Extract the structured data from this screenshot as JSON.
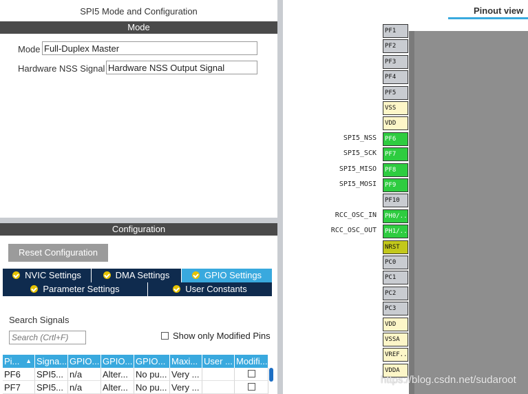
{
  "mode_panel": {
    "title": "SPI5 Mode and Configuration",
    "section_label": "Mode",
    "fields": [
      {
        "label": "Mode",
        "value": "Full-Duplex Master"
      },
      {
        "label": "Hardware NSS Signal",
        "value": "Hardware NSS Output Signal"
      }
    ]
  },
  "config_panel": {
    "section_label": "Configuration",
    "reset_button": "Reset Configuration",
    "tabs_row1": [
      {
        "label": "NVIC Settings",
        "active": false
      },
      {
        "label": "DMA Settings",
        "active": false
      },
      {
        "label": "GPIO Settings",
        "active": true
      }
    ],
    "tabs_row2": [
      {
        "label": "Parameter Settings"
      },
      {
        "label": "User Constants"
      }
    ],
    "search_label": "Search Signals",
    "search_placeholder": "Search (Crtl+F)",
    "show_modified_label": "Show only Modified Pins",
    "table": {
      "headers": [
        "Pi...",
        "Signa...",
        "GPIO...",
        "GPIO...",
        "GPIO...",
        "Maxi...",
        "User ...",
        "Modifi..."
      ],
      "rows": [
        [
          "PF6",
          "SPI5...",
          "n/a",
          "Alter...",
          "No pu...",
          "Very ...",
          "",
          ""
        ],
        [
          "PF7",
          "SPI5...",
          "n/a",
          "Alter...",
          "No pu...",
          "Very ...",
          "",
          ""
        ]
      ]
    }
  },
  "pinout": {
    "tab_label": "Pinout view",
    "colors": {
      "gray": "#c9ccd1",
      "yellow": "#fdf6c8",
      "green": "#2ecc40",
      "olive": "#c3c81b"
    },
    "pins": [
      {
        "name": "PF1",
        "color": "gray",
        "signal": ""
      },
      {
        "name": "PF2",
        "color": "gray",
        "signal": ""
      },
      {
        "name": "PF3",
        "color": "gray",
        "signal": ""
      },
      {
        "name": "PF4",
        "color": "gray",
        "signal": ""
      },
      {
        "name": "PF5",
        "color": "gray",
        "signal": ""
      },
      {
        "name": "VSS",
        "color": "yellow",
        "signal": ""
      },
      {
        "name": "VDD",
        "color": "yellow",
        "signal": ""
      },
      {
        "name": "PF6",
        "color": "green",
        "signal": "SPI5_NSS"
      },
      {
        "name": "PF7",
        "color": "green",
        "signal": "SPI5_SCK"
      },
      {
        "name": "PF8",
        "color": "green",
        "signal": "SPI5_MISO"
      },
      {
        "name": "PF9",
        "color": "green",
        "signal": "SPI5_MOSI"
      },
      {
        "name": "PF10",
        "color": "gray",
        "signal": ""
      },
      {
        "name": "PH0/..",
        "color": "green",
        "signal": "RCC_OSC_IN"
      },
      {
        "name": "PH1/..",
        "color": "green",
        "signal": "RCC_OSC_OUT"
      },
      {
        "name": "NRST",
        "color": "olive",
        "signal": ""
      },
      {
        "name": "PC0",
        "color": "gray",
        "signal": ""
      },
      {
        "name": "PC1",
        "color": "gray",
        "signal": ""
      },
      {
        "name": "PC2",
        "color": "gray",
        "signal": ""
      },
      {
        "name": "PC3",
        "color": "gray",
        "signal": ""
      },
      {
        "name": "VDD",
        "color": "yellow",
        "signal": ""
      },
      {
        "name": "VSSA",
        "color": "yellow",
        "signal": ""
      },
      {
        "name": "VREF...",
        "color": "yellow",
        "signal": ""
      },
      {
        "name": "VDDA",
        "color": "yellow",
        "signal": ""
      }
    ]
  },
  "watermark": "https://blog.csdn.net/sudaroot"
}
